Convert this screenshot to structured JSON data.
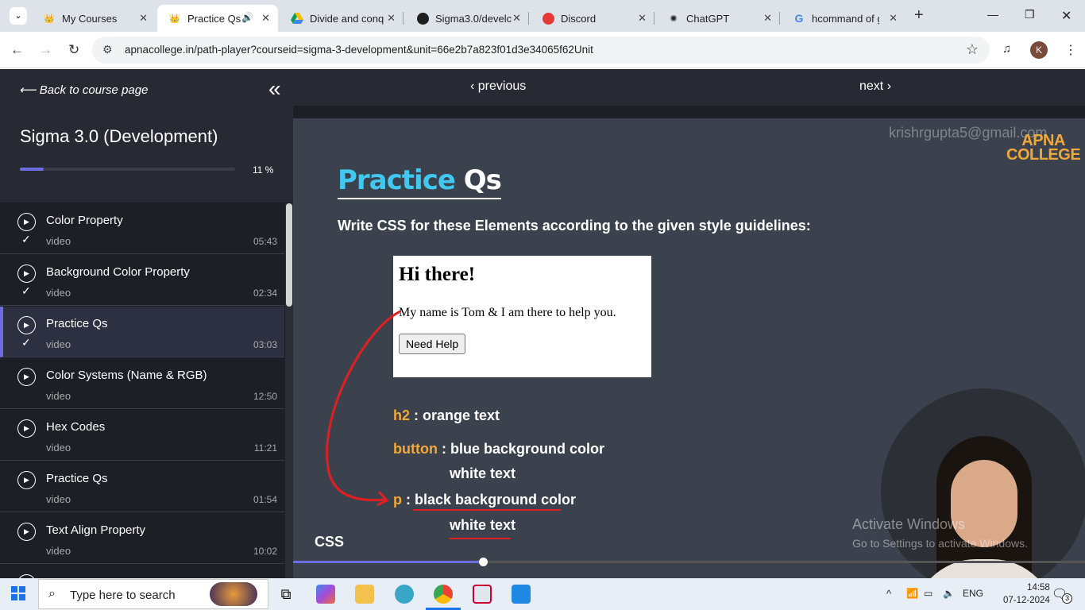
{
  "browser": {
    "tabs": [
      {
        "title": "My Courses",
        "icon": "apna-college-icon"
      },
      {
        "title": "Practice Qs",
        "icon": "apna-college-icon",
        "active": true
      },
      {
        "title": "Divide and conq",
        "icon": "google-drive-icon"
      },
      {
        "title": "Sigma3.0/develc",
        "icon": "github-icon"
      },
      {
        "title": "Discord",
        "icon": "discord-icon"
      },
      {
        "title": "ChatGPT",
        "icon": "chatgpt-icon"
      },
      {
        "title": "hcommand of gi",
        "icon": "google-icon"
      }
    ],
    "url": "apnacollege.in/path-player?courseid=sigma-3-development&unit=66e2b7a823f01d3e34065f62Unit",
    "profile_initial": "K"
  },
  "sidebar": {
    "back_label": "Back to course page",
    "course_title": "Sigma 3.0 (Development)",
    "progress_percent": 11,
    "progress_label": "11 %",
    "lessons": [
      {
        "title": "Color Property",
        "type": "video",
        "duration": "05:43",
        "done": true
      },
      {
        "title": "Background Color Property",
        "type": "video",
        "duration": "02:34",
        "done": true
      },
      {
        "title": "Practice Qs",
        "type": "video",
        "duration": "03:03",
        "done": true,
        "active": true
      },
      {
        "title": "Color Systems (Name & RGB)",
        "type": "video",
        "duration": "12:50",
        "done": false
      },
      {
        "title": "Hex Codes",
        "type": "video",
        "duration": "11:21",
        "done": false
      },
      {
        "title": "Practice Qs",
        "type": "video",
        "duration": "01:54",
        "done": false
      },
      {
        "title": "Text Align Property",
        "type": "video",
        "duration": "10:02",
        "done": false
      }
    ]
  },
  "player": {
    "prev_label": "previous",
    "next_label": "next",
    "watermark_email": "krishrgupta5@gmail.com",
    "logo_line1": "APNA",
    "logo_line2": "COLLEGE",
    "slide_title_1": "Practice",
    "slide_title_2": "Qs",
    "slide_subtitle": "Write CSS for these Elements according to the given style guidelines:",
    "demo_heading": "Hi there!",
    "demo_paragraph": "My name is Tom & I am there to help you.",
    "demo_button": "Need Help",
    "rules": [
      {
        "key": "h2",
        "text": ": orange text"
      },
      {
        "key": "button",
        "text": ": blue background color"
      },
      {
        "key": "",
        "text": "white text"
      },
      {
        "key": "p",
        "text": ": black background color"
      },
      {
        "key": "",
        "text": "white text"
      }
    ],
    "topic_label": "CSS",
    "seek_fraction": 0.24,
    "windows_watermark_1": "Activate Windows",
    "windows_watermark_2": "Go to Settings to activate Windows."
  },
  "taskbar": {
    "search_placeholder": "Type here to search",
    "language": "ENG",
    "time": "14:58",
    "date": "07-12-2024",
    "notification_count": "3"
  },
  "colors": {
    "accent": "#6b6de0",
    "heading_blue": "#40c8f0",
    "orange": "#f0a93a",
    "annotation_red": "#e02020"
  }
}
